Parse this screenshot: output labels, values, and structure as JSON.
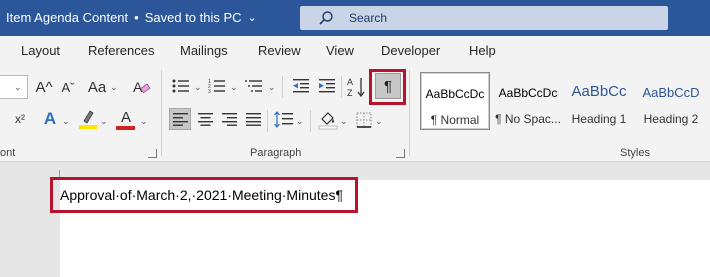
{
  "title_bar": {
    "doc_name": "Item Agenda Content",
    "separator": "•",
    "save_state": "Saved to this PC",
    "chevron": "⌄",
    "search_label": "Search",
    "search_icon": "search-icon"
  },
  "menu": {
    "tabs": [
      "Layout",
      "References",
      "Mailings",
      "Review",
      "View",
      "Developer",
      "Help"
    ]
  },
  "ribbon": {
    "font_group_label": "ont",
    "paragraph_group_label": "Paragraph",
    "styles_group_label": "Styles",
    "show_hide_glyph": "¶",
    "styles": [
      {
        "preview": "AaBbCcDc",
        "name": "¶ Normal"
      },
      {
        "preview": "AaBbCcDc",
        "name": "¶ No Spac..."
      },
      {
        "preview": "AaBbCc",
        "name": "Heading 1"
      },
      {
        "preview": "AaBbCcD",
        "name": "Heading 2"
      }
    ],
    "glyphs": {
      "grow_font": "A^",
      "shrink_font": "Aˇ",
      "change_case": "Aa",
      "superscript": "x²",
      "text_effects": "A",
      "font_color_letter": "A",
      "sort": "A↓Z"
    },
    "colors": {
      "highlight": "#ffe600",
      "font_color": "#d32020",
      "highlight_frame": "#b5142c"
    }
  },
  "document": {
    "text": "Approval·of·March·2,·2021·Meeting·Minutes¶"
  }
}
